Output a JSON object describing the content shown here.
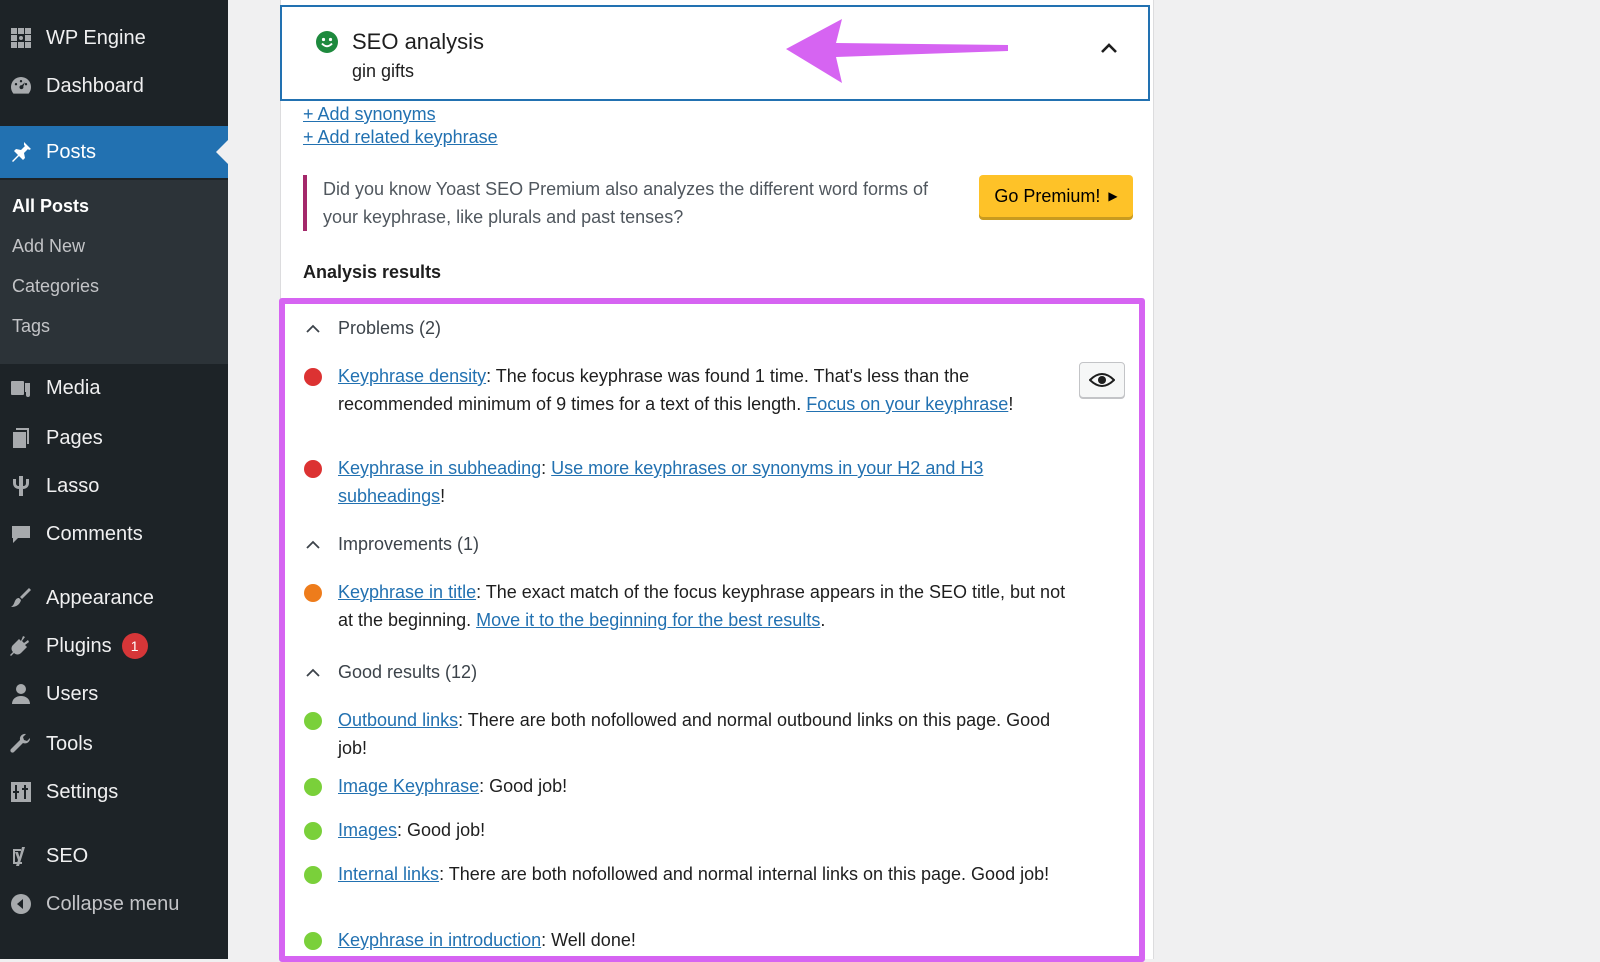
{
  "sidebar": {
    "items": [
      {
        "label": "WP Engine",
        "icon": "wp-engine-icon"
      },
      {
        "label": "Dashboard",
        "icon": "dashboard-icon"
      },
      {
        "label": "Posts",
        "icon": "pushpin-icon"
      },
      {
        "label": "Media",
        "icon": "media-icon"
      },
      {
        "label": "Pages",
        "icon": "pages-icon"
      },
      {
        "label": "Lasso",
        "icon": "lasso-icon"
      },
      {
        "label": "Comments",
        "icon": "comments-icon"
      },
      {
        "label": "Appearance",
        "icon": "appearance-icon"
      },
      {
        "label": "Plugins",
        "icon": "plugins-icon",
        "badge": "1"
      },
      {
        "label": "Users",
        "icon": "users-icon"
      },
      {
        "label": "Tools",
        "icon": "tools-icon"
      },
      {
        "label": "Settings",
        "icon": "settings-icon"
      },
      {
        "label": "SEO",
        "icon": "yoast-icon"
      }
    ],
    "submenu": [
      "All Posts",
      "Add New",
      "Categories",
      "Tags"
    ],
    "collapse_label": "Collapse menu"
  },
  "seo": {
    "title": "SEO analysis",
    "keyphrase": "gin gifts",
    "add_synonyms": "+ Add synonyms",
    "add_related": "+ Add related keyphrase",
    "premium_text": "Did you know Yoast SEO Premium also analyzes the different word forms of your keyphrase, like plurals and past tenses?",
    "premium_button": "Go Premium!",
    "results_heading": "Analysis results"
  },
  "groups": {
    "problems": "Problems (2)",
    "improvements": "Improvements (1)",
    "good": "Good results (12)"
  },
  "results": {
    "r1": {
      "link": "Keyphrase density",
      "text": ": The focus keyphrase was found 1 time. That's less than the recommended minimum of 9 times for a text of this length. ",
      "link2": "Focus on your keyphrase",
      "end": "!"
    },
    "r2": {
      "link": "Keyphrase in subheading",
      "text": ": ",
      "link2": "Use more keyphrases or synonyms in your H2 and H3 subheadings",
      "end": "!"
    },
    "r3": {
      "link": "Keyphrase in title",
      "text": ": The exact match of the focus keyphrase appears in the SEO title, but not at the beginning. ",
      "link2": "Move it to the beginning for the best results",
      "end": "."
    },
    "r4": {
      "link": "Outbound links",
      "text": ": There are both nofollowed and normal outbound links on this page. Good job!"
    },
    "r5": {
      "link": "Image Keyphrase",
      "text": ": Good job!"
    },
    "r6": {
      "link": "Images",
      "text": ": Good job!"
    },
    "r7": {
      "link": "Internal links",
      "text": ": There are both nofollowed and normal internal links on this page. Good job!"
    },
    "r8": {
      "link": "Keyphrase in introduction",
      "text": ": Well done!"
    }
  },
  "colors": {
    "sidebar_bg": "#1d2327",
    "active_blue": "#2271b1",
    "highlight": "#d664f2",
    "bad": "#dc3232",
    "ok": "#ee7c1b",
    "good": "#7ad03a",
    "premium": "#fec228"
  }
}
